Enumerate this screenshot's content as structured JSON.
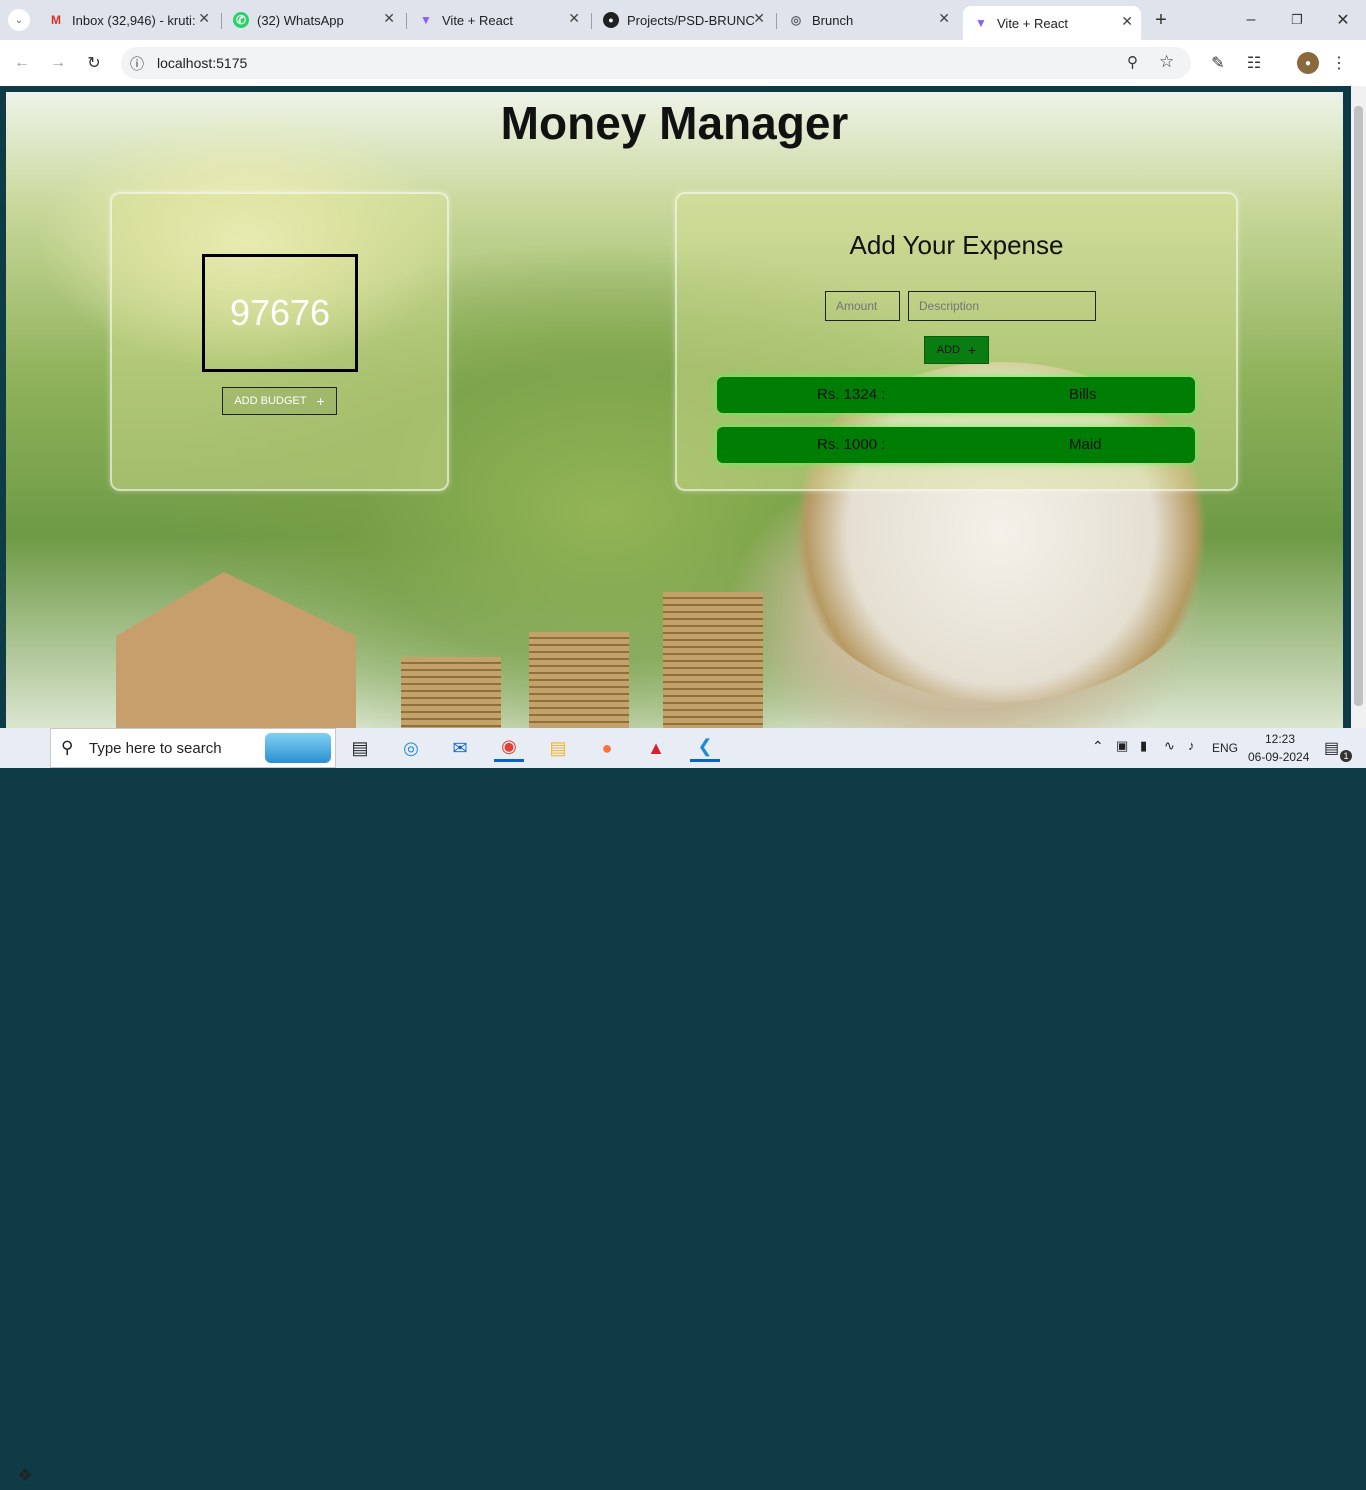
{
  "browser": {
    "tabs": [
      {
        "label": "Inbox (32,946) - kruti:",
        "icon": "gmail-icon"
      },
      {
        "label": "(32) WhatsApp",
        "icon": "whatsapp-icon"
      },
      {
        "label": "Vite + React",
        "icon": "vite-icon"
      },
      {
        "label": "Projects/PSD-BRUNC",
        "icon": "github-icon"
      },
      {
        "label": "Brunch",
        "icon": "globe-icon"
      },
      {
        "label": "Vite + React",
        "icon": "vite-icon",
        "active": true
      }
    ],
    "url": "localhost:5175"
  },
  "app": {
    "title": "Money Manager",
    "budget": {
      "value": "97676",
      "add_label": "ADD BUDGET"
    },
    "expense": {
      "title": "Add Your Expense",
      "amount_placeholder": "Amount",
      "description_placeholder": "Description",
      "add_label": "ADD",
      "items": [
        {
          "amount": "Rs. 1324 :",
          "description": "Bills"
        },
        {
          "amount": "Rs. 1000 :",
          "description": "Maid"
        }
      ]
    }
  },
  "colors": {
    "accent_green": "#007d05"
  },
  "taskbar": {
    "search_placeholder": "Type here to search",
    "language": "ENG",
    "time": "12:23",
    "date": "06-09-2024",
    "notification_count": "1"
  }
}
